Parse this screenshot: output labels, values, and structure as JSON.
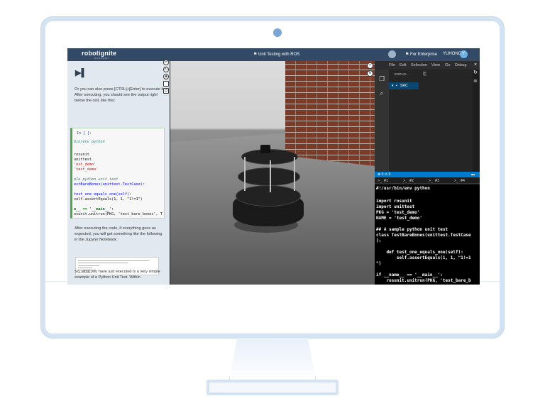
{
  "header": {
    "logo": "robotignite",
    "logo_sub": "ACADEMY",
    "course_title": "Unit Testing with ROS",
    "enterprise": "For Enterprise",
    "username": "YUHONG",
    "avatar_text": "Y"
  },
  "notebook": {
    "play_icon": "▶▌",
    "intro_text": "Or you can also press [CTRL]+[Enter] to execute it. After executing, you should see the output right below the cell, like this:",
    "cell_prompt": "In [ ]:",
    "code": {
      "l1": "bin/env python",
      "l2": "rosunit",
      "l3": "unittest",
      "l4": "'est_demo'",
      "l5": "'test_demo'",
      "l6": "ple python unit test",
      "l7": "estBareBones(unittest.TestCase):",
      "l8": "test_one_equals_one(self):",
      "l9": "self.assertEquals(1, 1, \"1!=1\")",
      "l10": "e__ == '__main__':",
      "l11": "osunit.unitrun(PKG, 'test_bare_bones', T"
    },
    "after_text": "After executing the code, if everything goes as expected, you will get something like the following in the Jupyter Notebook:",
    "closing_text": "So, what you have just executed is a very simple example of a Python Unit Test. Within"
  },
  "toolbar_icons": [
    "close-icon",
    "refresh-icon",
    "stop-icon",
    "square-icon",
    "camera-icon"
  ],
  "ide": {
    "menu": [
      "File",
      "Edit",
      "Selection",
      "View",
      "Go",
      "Debug"
    ],
    "explorer_title": "EXPLO...",
    "folder": "SRC",
    "status": "⊗ 0 ⚠ 0",
    "term_tabs": [
      ">_ #1",
      ">_ #2",
      ">_ #3",
      ">_ #4"
    ],
    "terminal": {
      "t1": "#!/usr/bin/env python",
      "t2": "import rosunit",
      "t3": "import unittest",
      "t4": "PKG = 'test_demo'",
      "t5": "NAME = 'test_demo'",
      "t6": "## A sample python unit test",
      "t7": "class TestBareBones(unittest.TestCase",
      "t8": "):",
      "t9": "    def test_one_equals_one(self):",
      "t10": "        self.assertEquals(1, 1, \"1!=1",
      "t11": "\")",
      "t12": "if __name__ == '__main__':",
      "t13": "    rosunit.unitrun(PKG, 'test_bare_b"
    }
  },
  "colors": {
    "topbar": "#334a66",
    "accent": "#007acc",
    "cell_border": "#4ea64e"
  }
}
